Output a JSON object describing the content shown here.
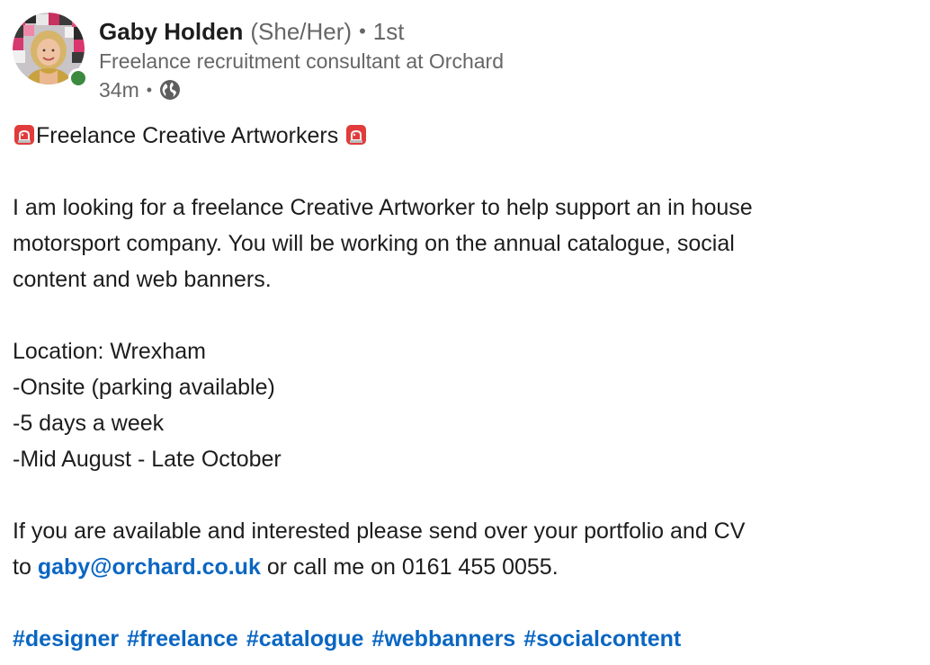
{
  "author": {
    "name": "Gaby Holden",
    "pronouns": "(She/Her)",
    "separator": "•",
    "degree": "1st",
    "headline": "Freelance recruitment consultant at Orchard",
    "avatar_icon": "profile-photo",
    "presence_status_color": "#3c8a3f"
  },
  "meta": {
    "timestamp": "34m",
    "separator": "•",
    "visibility_icon": "globe-icon"
  },
  "post": {
    "title": "Freelance Creative Artworkers",
    "title_icon": "siren-icon",
    "paragraph1": [
      "I am looking for a freelance Creative Artworker to help support an in house",
      "motorsport company. You will be working on the annual catalogue, social",
      "content and web banners."
    ],
    "details": [
      "Location: Wrexham",
      "-Onsite (parking available)",
      "-5 days a week",
      "-Mid August - Late October"
    ],
    "contact_line1": "If you are available and interested please send over your portfolio and CV",
    "contact_prefix": "to",
    "contact_email": "gaby@orchard.co.uk",
    "contact_suffix": "or call me on 0161 455 0055.",
    "hashtags": [
      "#designer",
      "#freelance",
      "#catalogue",
      "#webbanners",
      "#socialcontent"
    ]
  },
  "colors": {
    "link": "#0a66c2",
    "text": "#1d1d1d",
    "muted": "#666666"
  }
}
